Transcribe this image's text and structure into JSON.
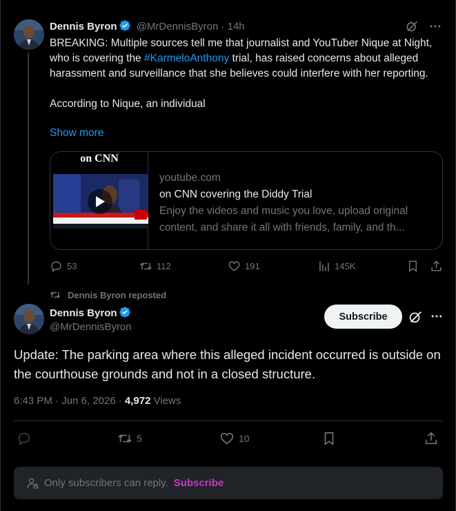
{
  "tweet1": {
    "author_name": "Dennis Byron",
    "handle": "@MrDennisByron",
    "time": "· 14h",
    "text_before_hashtag": "BREAKING: Multiple sources tell me that journalist and YouTuber Nique at Night, who is covering the ",
    "hashtag": "#KarmeloAnthony",
    "text_after_hashtag": " trial, has raised concerns about alleged harassment and surveillance that she believes could interfere with her reporting.\n\nAccording to Nique, an individual",
    "show_more": "Show more",
    "card": {
      "thumb_title": "on CNN",
      "domain": "youtube.com",
      "title": "on CNN covering the Diddy Trial",
      "description": "Enjoy the videos and music you love, upload original content, and share it all with friends, family, and th..."
    },
    "stats": {
      "replies": "53",
      "reposts": "112",
      "likes": "191",
      "views": "145K"
    }
  },
  "repost_label": "Dennis Byron reposted",
  "tweet2": {
    "author_name": "Dennis Byron",
    "handle": "@MrDennisByron",
    "subscribe_label": "Subscribe",
    "text": "Update: The parking area where this alleged incident occurred is outside on the courthouse grounds and not in a closed structure.",
    "timestamp": "6:43 PM · Jun 6, 2026 · ",
    "views_count": "4,972",
    "views_label": " Views",
    "stats": {
      "replies": "",
      "reposts": "5",
      "likes": "10"
    }
  },
  "reply_bar": {
    "text": "Only subscribers can reply.",
    "link": "Subscribe"
  },
  "colors": {
    "accent": "#1d9bf0",
    "subscribe_link": "#c936cc",
    "background": "#000000"
  }
}
